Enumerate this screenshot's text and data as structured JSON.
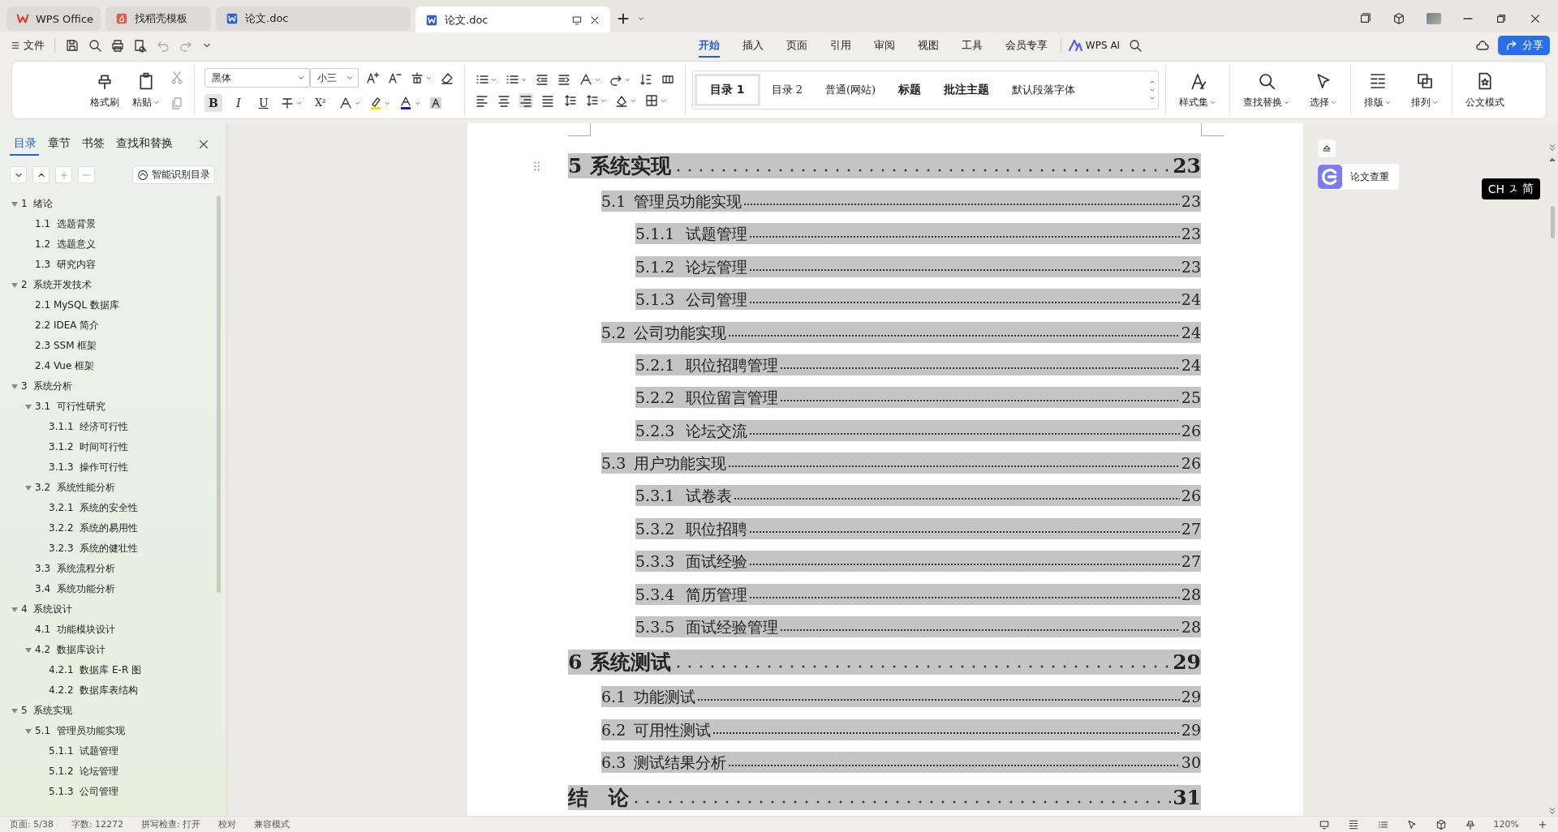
{
  "tabs": [
    {
      "label": "WPS Office",
      "kind": "home",
      "selected": false
    },
    {
      "label": "找稻壳模板",
      "kind": "template",
      "selected": false
    },
    {
      "label": "论文.doc",
      "kind": "doc",
      "selected": false
    },
    {
      "label": "论文.doc",
      "kind": "doc",
      "selected": true
    }
  ],
  "file_menu": "文件",
  "menu_tabs": [
    {
      "label": "开始",
      "selected": true
    },
    {
      "label": "插入",
      "selected": false
    },
    {
      "label": "页面",
      "selected": false
    },
    {
      "label": "引用",
      "selected": false
    },
    {
      "label": "审阅",
      "selected": false
    },
    {
      "label": "视图",
      "selected": false
    },
    {
      "label": "工具",
      "selected": false
    },
    {
      "label": "会员专享",
      "selected": false
    }
  ],
  "ai_label": "WPS AI",
  "share_button": "分享",
  "ribbon": {
    "clipboard": [
      "格式刷",
      "粘贴"
    ],
    "font_name": "黑体",
    "font_size": "小三",
    "format_buttons": [
      "B",
      "I",
      "U",
      "X²"
    ],
    "styles": [
      {
        "label": "目录 1",
        "kind": "heading",
        "selected": true
      },
      {
        "label": "目录 2",
        "kind": "plain",
        "selected": false
      },
      {
        "label": "普通(网站)",
        "kind": "plain",
        "selected": false
      },
      {
        "label": "标题",
        "kind": "heading",
        "selected": false
      },
      {
        "label": "批注主题",
        "kind": "heading",
        "selected": false
      },
      {
        "label": "默认段落字体",
        "kind": "plain",
        "selected": false
      }
    ],
    "tools": [
      "样式集",
      "查找替换",
      "选择",
      "排版",
      "排列",
      "公文模式"
    ]
  },
  "sidebar": {
    "tabs": [
      {
        "label": "目录",
        "selected": true
      },
      {
        "label": "章节",
        "selected": false
      },
      {
        "label": "书签",
        "selected": false
      },
      {
        "label": "查找和替换",
        "selected": false
      }
    ],
    "smart_button": "智能识别目录",
    "tree": [
      {
        "label": "1  绪论",
        "expanded": true,
        "children": [
          {
            "label": "1.1  选题背景"
          },
          {
            "label": "1.2  选题意义"
          },
          {
            "label": "1.3  研究内容"
          }
        ]
      },
      {
        "label": "2  系统开发技术",
        "expanded": true,
        "children": [
          {
            "label": "2.1 MySQL 数据库"
          },
          {
            "label": "2.2 IDEA 简介"
          },
          {
            "label": "2.3 SSM 框架"
          },
          {
            "label": "2.4 Vue 框架"
          }
        ]
      },
      {
        "label": "3  系统分析",
        "expanded": true,
        "children": [
          {
            "label": "3.1  可行性研究",
            "expanded": true,
            "children": [
              {
                "label": "3.1.1  经济可行性"
              },
              {
                "label": "3.1.2  时间可行性"
              },
              {
                "label": "3.1.3  操作可行性"
              }
            ]
          },
          {
            "label": "3.2  系统性能分析",
            "expanded": true,
            "children": [
              {
                "label": "3.2.1  系统的安全性"
              },
              {
                "label": "3.2.2  系统的易用性"
              },
              {
                "label": "3.2.3  系统的健壮性"
              }
            ]
          },
          {
            "label": "3.3  系统流程分析"
          },
          {
            "label": "3.4  系统功能分析"
          }
        ]
      },
      {
        "label": "4  系统设计",
        "expanded": true,
        "children": [
          {
            "label": "4.1  功能模块设计"
          },
          {
            "label": "4.2  数据库设计",
            "expanded": true,
            "children": [
              {
                "label": "4.2.1  数据库 E-R 图"
              },
              {
                "label": "4.2.2  数据库表结构"
              }
            ]
          }
        ]
      },
      {
        "label": "5  系统实现",
        "expanded": true,
        "children": [
          {
            "label": "5.1  管理员功能实现",
            "expanded": true,
            "children": [
              {
                "label": "5.1.1  试题管理"
              },
              {
                "label": "5.1.2  论坛管理"
              },
              {
                "label": "5.1.3  公司管理"
              }
            ]
          }
        ]
      }
    ]
  },
  "document": {
    "toc": [
      {
        "number": "5",
        "title": "系统实现",
        "page": "23",
        "children": [
          {
            "number": "5.1",
            "title": "管理员功能实现",
            "page": "23",
            "children": [
              {
                "number": "5.1.1",
                "title": "试题管理",
                "page": "23"
              },
              {
                "number": "5.1.2",
                "title": "论坛管理",
                "page": "23"
              },
              {
                "number": "5.1.3",
                "title": "公司管理",
                "page": "24"
              }
            ]
          },
          {
            "number": "5.2",
            "title": "公司功能实现",
            "page": "24",
            "children": [
              {
                "number": "5.2.1",
                "title": "职位招聘管理",
                "page": "24"
              },
              {
                "number": "5.2.2",
                "title": "职位留言管理",
                "page": "25"
              },
              {
                "number": "5.2.3",
                "title": "论坛交流",
                "page": "26"
              }
            ]
          },
          {
            "number": "5.3",
            "title": "用户功能实现",
            "page": "26",
            "children": [
              {
                "number": "5.3.1",
                "title": "试卷表",
                "page": "26"
              },
              {
                "number": "5.3.2",
                "title": "职位招聘",
                "page": "27"
              },
              {
                "number": "5.3.3",
                "title": "面试经验",
                "page": "27"
              },
              {
                "number": "5.3.4",
                "title": "简历管理",
                "page": "28"
              },
              {
                "number": "5.3.5",
                "title": "面试经验管理",
                "page": "28"
              }
            ]
          }
        ]
      },
      {
        "number": "6",
        "title": "系统测试",
        "page": "29",
        "children": [
          {
            "number": "6.1",
            "title": "功能测试",
            "page": "29"
          },
          {
            "number": "6.2",
            "title": "可用性测试",
            "page": "29"
          },
          {
            "number": "6.3",
            "title": "测试结果分析",
            "page": "30"
          }
        ]
      },
      {
        "title": "结　论",
        "page": "31"
      }
    ]
  },
  "right_panel": {
    "plagiarism_button": "论文查重",
    "ime_language": "CH",
    "ime_mode": "简"
  },
  "status_bar": [
    "页面: 5/38",
    "字数: 12272",
    "拼写检查: 打开",
    "校对",
    "兼容模式"
  ],
  "zoom_level": "120%"
}
